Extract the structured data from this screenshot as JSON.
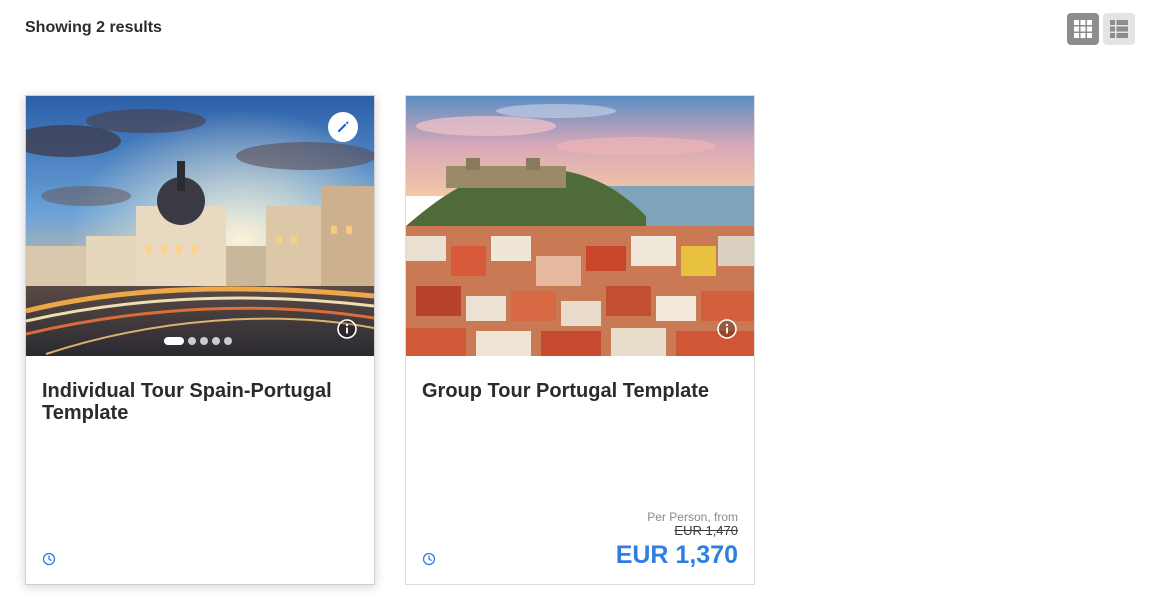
{
  "results": {
    "summary": "Showing 2 results"
  },
  "view_toggle": {
    "active": "grid-view",
    "grid_icon": "grid-icon",
    "list_icon": "list-icon"
  },
  "cards": [
    {
      "title": "Individual Tour Spain-Portugal Template",
      "icons": [
        "pencil-icon",
        "info-icon",
        "clock-icon"
      ],
      "carousel": {
        "slides": 5,
        "active": 1
      }
    },
    {
      "title": "Group Tour Portugal Template",
      "icons": [
        "info-icon",
        "clock-icon"
      ],
      "price": {
        "note": "Per Person, from",
        "original": "EUR 1,470",
        "current": "EUR 1,370"
      }
    }
  ],
  "colors": {
    "accent": "#2f7fe3",
    "toggle_active": "#8d8d8d",
    "toggle_inactive": "#e4e4e4"
  }
}
